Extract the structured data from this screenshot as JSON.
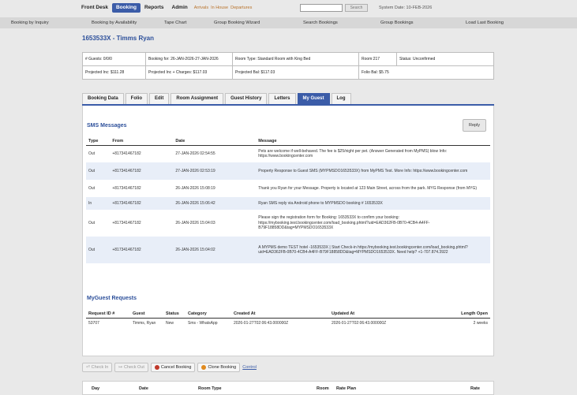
{
  "topnav": {
    "items": [
      "Front Desk",
      "Booking",
      "Reports",
      "Admin"
    ],
    "active_index": 1,
    "links": [
      "Arrivals",
      "In House",
      "Departures"
    ],
    "search_label": "Search",
    "system_date": "System Date: 10-FEB-2026"
  },
  "subnav": {
    "items": [
      "Booking by Inquiry",
      "Booking by Availability",
      "Tape Chart",
      "Group Booking Wizard",
      "Search Bookings",
      "Group Bookings",
      "Load Last Booking"
    ]
  },
  "guest_title": "1653533X - Timms Ryan",
  "info": {
    "guests": "# Guests: 0/0/0",
    "booking_for": "Booking for: 26-JAN-2026-27-JAN-2026",
    "room_type": "Room Type: Standard Room with King Bed",
    "room": "Room:217",
    "status": "Status: Unconfirmed",
    "projected_inc": "Projected Inc: $111.28",
    "projected_charges": "Projected Inc + Charges: $117.03",
    "projected_bal": "Projected Bal: $117.03",
    "folio_bal": "Folio Bal: $5.75"
  },
  "tabs": [
    "Booking Data",
    "Folio",
    "Edit",
    "Room Assignment",
    "Guest History",
    "Letters",
    "My Guest",
    "Log"
  ],
  "active_tab": 6,
  "sms": {
    "title": "SMS Messages",
    "reply_label": "Reply",
    "headers": [
      "Type",
      "From",
      "Date",
      "Message"
    ],
    "rows": [
      {
        "type": "Out",
        "from": "+817341467182",
        "date": "27-JAN-2026 02:54:55",
        "message": "Pets are welcome if well-behaved. The fee is $25/night per pet. (Answer Generated from MyPMS) blow Info: https://www.bookingcenter.com"
      },
      {
        "type": "Out",
        "from": "+817341467182",
        "date": "27-JAN-2026 02:53:19",
        "message": "Property Response to Guest SMS (MYPMSDO1653533X) from MyPMS Test. More Info: https://www.bookingcenter.com"
      },
      {
        "type": "Out",
        "from": "+817341467182",
        "date": "26-JAN-2026 15:08:19",
        "message": "Thank you Ryan for your Message. Property is located at 123 Main Street, across from the park. MYG Response (from MYG)"
      },
      {
        "type": "In",
        "from": "+817341467182",
        "date": "26-JAN-2026 15:06:42",
        "message": "Ryan SMS reply via Android phone to MYPMSDO booking # 1653533X"
      },
      {
        "type": "Out",
        "from": "+817341467182",
        "date": "26-JAN-2026 15:04:03",
        "message": "Please sign the registration form for Booking: 1653533X to confirm your booking: https://mybooking.test.bookingcenter.com/load_booking.phtml?uid=EAD362FB-0B70-4CB4-A4FF-B79F18858DD&tag=MYPMSDO1653533X"
      },
      {
        "type": "Out",
        "from": "+817341467182",
        "date": "26-JAN-2026 15:04:02",
        "message": "A MYPMS demo TEST hotel -1653533X | Start Check-in https://mybooking.test.bookingcenter.com/load_booking.phtml?uid=EAD362FB-0B70-4CB4-A4FF-B79F18858DD&tag=MYPMSDO1653533X. Need help? +1-707.874.3922"
      }
    ]
  },
  "requests": {
    "title": "MyGuest Requests",
    "headers": [
      "Request ID #",
      "Guest",
      "Status",
      "Category",
      "Created At",
      "Updated At",
      "Length Open"
    ],
    "rows": [
      {
        "id": "53707",
        "guest": "Timms, Ryan",
        "status": "New",
        "category": "Sms - WhatsApp",
        "created": "2026-01-27T02:06:43.000000Z",
        "updated": "2026-01-27T02:06:43.000000Z",
        "length": "2 weeks"
      }
    ]
  },
  "actions": {
    "checkin": "Check In",
    "checkout": "Check Out",
    "cancel": "Cancel Booking",
    "clone": "Clone Booking",
    "control": "Control"
  },
  "bottom_headers": [
    "Day",
    "Date",
    "Room Type",
    "Room",
    "Rate Plan",
    "Rate"
  ]
}
